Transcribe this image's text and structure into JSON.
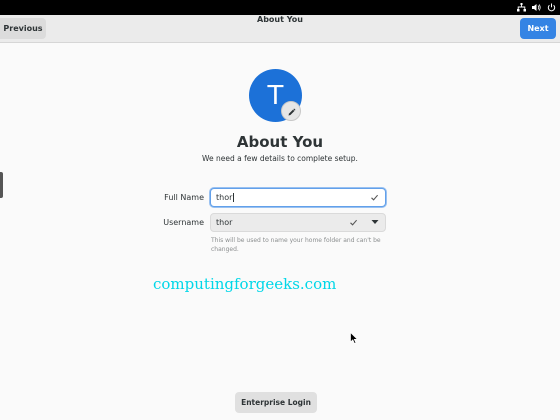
{
  "header": {
    "previous_label": "Previous",
    "title": "About You",
    "next_label": "Next"
  },
  "tray_icons": [
    "network-icon",
    "volume-icon",
    "power-icon"
  ],
  "avatar": {
    "initial": "T",
    "color": "#1c71d8"
  },
  "page": {
    "title": "About You",
    "subtitle": "We need a few details to complete setup."
  },
  "form": {
    "full_name_label": "Full Name",
    "full_name_value": "thor",
    "username_label": "Username",
    "username_value": "thor",
    "username_hint": "This will be used to name your home folder and can't be changed."
  },
  "watermark": "computingforgeeks.com",
  "enterprise_login_label": "Enterprise Login",
  "colors": {
    "accent": "#3584e4",
    "watermark": "#00d7e8"
  }
}
